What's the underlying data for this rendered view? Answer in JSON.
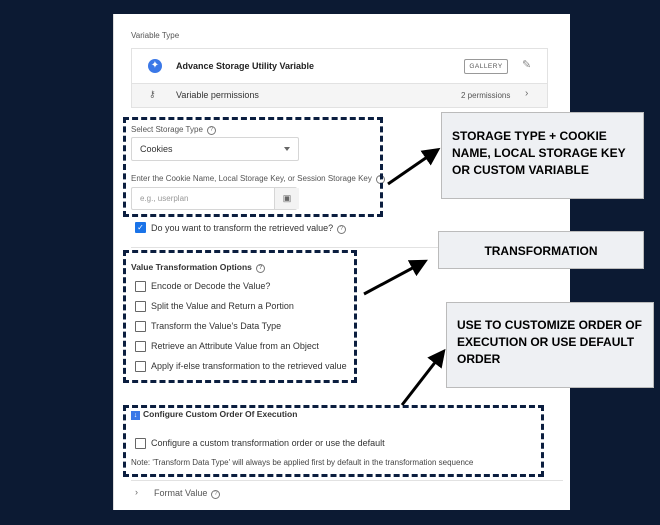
{
  "variable_type_label": "Variable Type",
  "variable_name": "Advance Storage Utility Variable",
  "gallery_label": "GALLERY",
  "permissions_label": "Variable permissions",
  "permissions_count": "2 permissions",
  "storage": {
    "select_label": "Select Storage Type",
    "selected_value": "Cookies",
    "key_label": "Enter the Cookie Name, Local Storage Key, or Session Storage Key",
    "key_placeholder": "e.g., userplan"
  },
  "transform_question": "Do you want to transform the retrieved value?",
  "transform_options": {
    "title": "Value Transformation Options",
    "items": [
      "Encode or Decode the Value?",
      "Split the Value and Return a Portion",
      "Transform the Value's Data Type",
      "Retrieve an Attribute Value from an Object",
      "Apply if-else transformation to the retrieved value"
    ]
  },
  "custom_order": {
    "title": "Configure Custom Order Of Execution",
    "checkbox_label": "Configure a custom transformation order or use the default",
    "note": "Note: 'Transform Data Type' will always be applied first by default in the transformation sequence"
  },
  "format_value_label": "Format Value",
  "callouts": {
    "storage": "STORAGE TYPE + COOKIE NAME, LOCAL STORAGE KEY OR CUSTOM VARIABLE",
    "transformation": "TRANSFORMATION",
    "order": "USE TO CUSTOMIZE ORDER OF EXECUTION OR USE DEFAULT ORDER"
  },
  "colors": {
    "background": "#0c1a33",
    "accent": "#1a73e8",
    "dash": "#0b1e3f"
  },
  "icons": [
    "gear-icon",
    "pencil-icon",
    "key-icon",
    "chevron-right-icon",
    "dropdown-caret-icon",
    "variable-icon",
    "help-icon",
    "download-arrow-icon"
  ]
}
